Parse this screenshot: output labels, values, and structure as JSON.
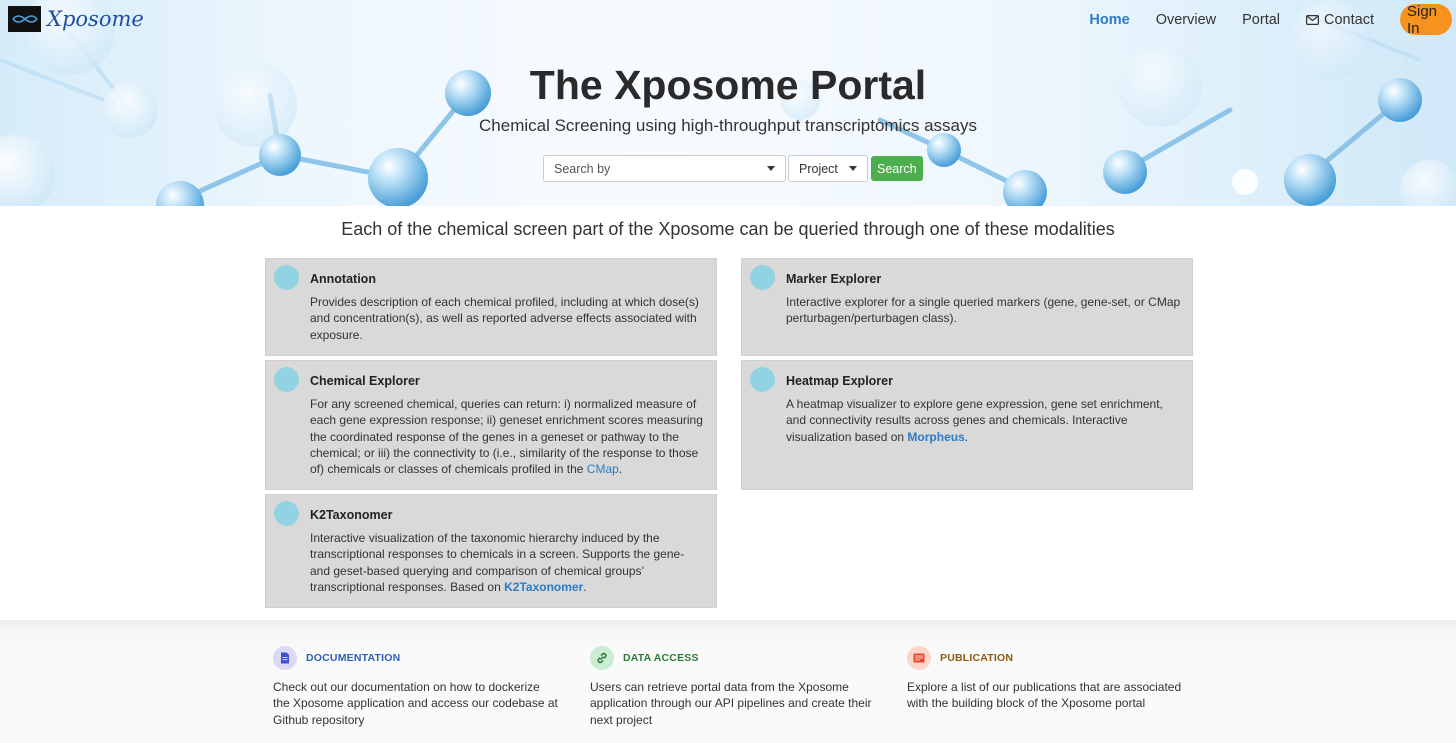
{
  "brand": {
    "name": "Xposome"
  },
  "nav": {
    "items": [
      {
        "label": "Home",
        "active": true
      },
      {
        "label": "Overview",
        "active": false
      },
      {
        "label": "Portal",
        "active": false
      },
      {
        "label": "Contact",
        "active": false
      }
    ],
    "sign_in": "Sign In"
  },
  "hero": {
    "title": "The Xposome Portal",
    "subtitle": "Chemical Screening using high-throughput transcriptomics assays",
    "search_by_placeholder": "Search by",
    "project_label": "Project",
    "search_button": "Search"
  },
  "modalities": {
    "heading": "Each of the chemical screen part of the Xposome can be queried through one of these modalities",
    "cards": [
      {
        "title": "Annotation",
        "text": "Provides description of each chemical profiled, including at which dose(s) and concentration(s), as well as reported adverse effects associated with exposure."
      },
      {
        "title": "Marker Explorer",
        "text": "Interactive explorer for a single queried markers (gene, gene-set, or CMap perturbagen/perturbagen class)."
      },
      {
        "title": "Chemical Explorer",
        "text": "For any screened chemical, queries can return: i) normalized measure of each gene expression response; ii) geneset enrichment scores measuring the coordinated response of the genes in a geneset or pathway to the chemical; or iii) the connectivity to (i.e., similarity of the response to those of) chemicals or classes of chemicals profiled in the",
        "link": "CMap",
        "suffix": "."
      },
      {
        "title": "Heatmap Explorer",
        "text": "A heatmap visualizer to explore gene expression, gene set enrichment, and connectivity results across genes and chemicals. Interactive visualization based on",
        "link": "Morpheus",
        "suffix": "."
      },
      {
        "title": "K2Taxonomer",
        "text": "Interactive visualization of the taxonomic hierarchy induced by the transcriptional responses to chemicals in a screen. Supports the gene- and geset-based querying and comparison of chemical groups’ transcriptional responses. Based on",
        "link": "K2Taxonomer",
        "suffix": "."
      }
    ]
  },
  "features": [
    {
      "label": "DOCUMENTATION",
      "text": "Check out our documentation on how to dockerize the Xposome application and access our codebase at Github repository",
      "icon": "document-icon",
      "color": "#3b4fd8",
      "bg": "#dcd9f7"
    },
    {
      "label": "DATA ACCESS",
      "text": "Users can retrieve portal data from the Xposome application through our API pipelines and create their next project",
      "icon": "link-icon",
      "color": "#2f7a3b",
      "bg": "#c9ecd2"
    },
    {
      "label": "PUBLICATION",
      "text": "Explore a list of our publications that are associated with the building block of the Xposome portal",
      "icon": "publication-icon",
      "color": "#8a5a12",
      "bg": "#fcd5cb"
    }
  ]
}
